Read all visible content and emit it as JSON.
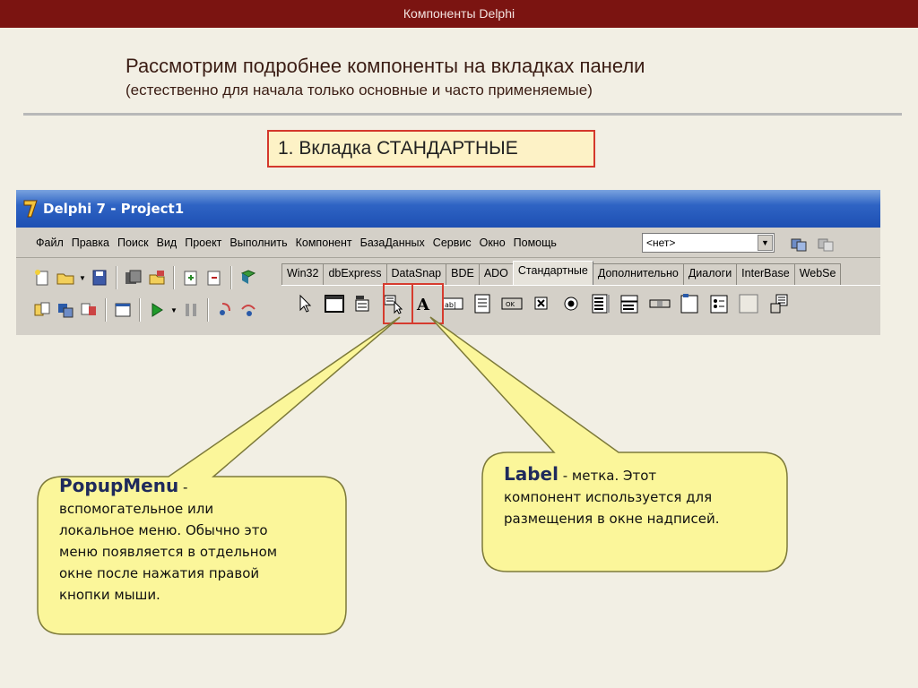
{
  "slide": {
    "header": "Компоненты Delphi",
    "title": "Рассмотрим подробнее компоненты на вкладках панели",
    "subtitle": "(естественно для начала только основные и часто применяемые)",
    "section": "1. Вкладка СТАНДАРТНЫЕ"
  },
  "window": {
    "title": "Delphi 7 - Project1",
    "menu": [
      "Файл",
      "Правка",
      "Поиск",
      "Вид",
      "Проект",
      "Выполнить",
      "Компонент",
      "БазаДанных",
      "Сервис",
      "Окно",
      "Помощь"
    ],
    "combo_value": "<нет>",
    "tabs": [
      "Win32",
      "dbExpress",
      "DataSnap",
      "BDE",
      "ADO",
      "Стандартные",
      "Дополнительно",
      "Диалоги",
      "InterBase",
      "WebSe"
    ],
    "active_tab": "Стандартные"
  },
  "callouts": {
    "popup": {
      "term": "PopupMenu",
      "dash": " -",
      "lines": [
        "вспомогательное или",
        "локальное меню. Обычно это",
        "меню появляется в отдельном",
        "окне после нажатия правой",
        "кнопки мыши."
      ]
    },
    "label": {
      "term": "Label",
      "dash": " - метка. Этот",
      "lines": [
        "компонент используется для",
        "размещения в окне  надписей."
      ]
    }
  },
  "colors": {
    "header_bg": "#7b1411",
    "callout_fill": "#fbf69a",
    "highlight": "#d63b2e",
    "titlebar": "#2f64c4"
  }
}
